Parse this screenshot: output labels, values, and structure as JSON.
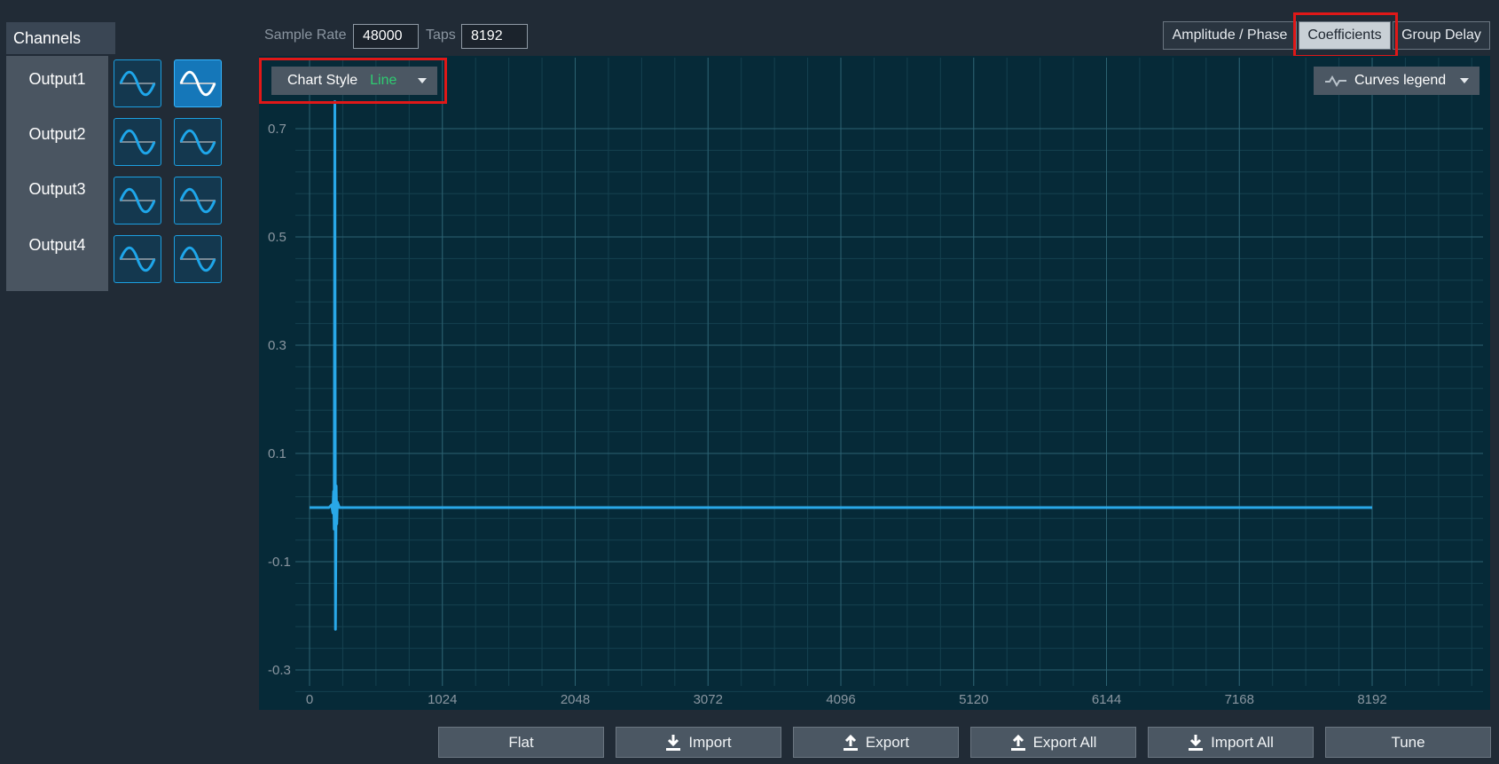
{
  "sidebar": {
    "title": "Channels",
    "outputs": [
      {
        "label": "Output1",
        "selected_index": 1
      },
      {
        "label": "Output2",
        "selected_index": -1
      },
      {
        "label": "Output3",
        "selected_index": -1
      },
      {
        "label": "Output4",
        "selected_index": -1
      }
    ]
  },
  "toolbar": {
    "sample_rate_label": "Sample Rate",
    "sample_rate_value": "48000",
    "taps_label": "Taps",
    "taps_value": "8192",
    "tabs": [
      "Amplitude / Phase",
      "Coefficients",
      "Group Delay"
    ],
    "active_tab": "Coefficients"
  },
  "chart_controls": {
    "style_label": "Chart Style",
    "style_value": "Line",
    "style_value_color": "#2ecc71",
    "legend_label": "Curves legend"
  },
  "chart_data": {
    "type": "line",
    "title": "",
    "xlabel": "",
    "ylabel": "",
    "xlim": [
      0,
      8192
    ],
    "ylim": [
      -0.3,
      0.7
    ],
    "x_ticks": [
      0,
      1024,
      2048,
      3072,
      4096,
      5120,
      6144,
      7168,
      8192
    ],
    "y_ticks": [
      0.7,
      0.5,
      0.3,
      0.1,
      -0.1,
      -0.3
    ],
    "grid": true,
    "series": [
      {
        "color": "#29a8e8",
        "points": [
          [
            0,
            0
          ],
          [
            150,
            0
          ],
          [
            170,
            0.005
          ],
          [
            180,
            -0.01
          ],
          [
            185,
            0.03
          ],
          [
            190,
            -0.04
          ],
          [
            195,
            0.75
          ],
          [
            200,
            -0.225
          ],
          [
            205,
            0.04
          ],
          [
            210,
            -0.03
          ],
          [
            215,
            0.01
          ],
          [
            230,
            0
          ],
          [
            8192,
            0
          ]
        ]
      }
    ]
  },
  "buttons": {
    "flat": "Flat",
    "import": "Import",
    "export": "Export",
    "export_all": "Export All",
    "import_all": "Import All",
    "tune": "Tune"
  },
  "colors": {
    "accent": "#1c9fe0",
    "highlight": "#e01818"
  },
  "icons": {
    "wave": "sine-wave-icon",
    "download": "download-icon",
    "upload": "upload-icon",
    "legend": "curve-icon",
    "dropdown": "chevron-down-icon"
  }
}
